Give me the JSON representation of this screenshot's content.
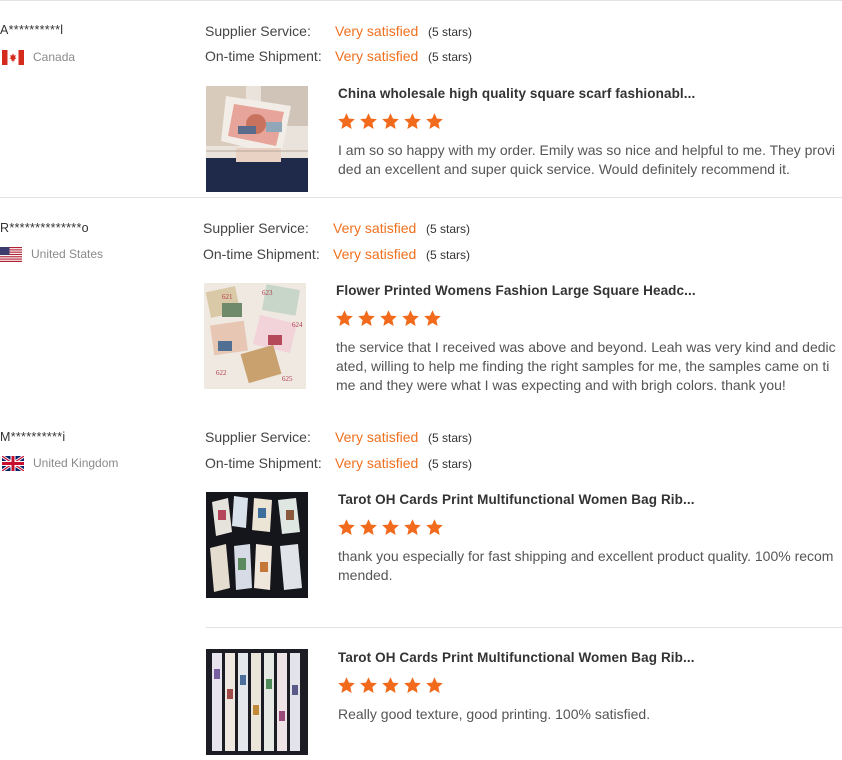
{
  "labels": {
    "supplier_service": "Supplier Service:",
    "ontime_shipment": "On-time Shipment:"
  },
  "reviews": [
    {
      "user": "A**********l",
      "country": "Canada",
      "supplier_value": "Very satisfied",
      "supplier_stars": "(5 stars)",
      "shipment_value": "Very satisfied",
      "shipment_stars": "(5 stars)",
      "products": [
        {
          "title": "China wholesale high quality square scarf fashionabl...",
          "rating": 5,
          "comment": "I am so so happy with my order. Emily was so nice and helpful to me. They provided an excellent and super quick service. Would definitely recommend it."
        }
      ]
    },
    {
      "user": "R**************o",
      "country": "United States",
      "supplier_value": "Very satisfied",
      "supplier_stars": "(5 stars)",
      "shipment_value": "Very satisfied",
      "shipment_stars": "(5 stars)",
      "products": [
        {
          "title": "Flower Printed Womens Fashion Large Square Headc...",
          "rating": 5,
          "comment": "the service that I received was above and beyond.  Leah was very kind and dedicated, willing to help me finding the right samples for me, the samples came on time and they were what I was expecting and with brigh colors. thank you!",
          "image_labels": [
            "621",
            "623",
            "624",
            "622",
            "625"
          ]
        }
      ]
    },
    {
      "user": "M**********i",
      "country": "United Kingdom",
      "supplier_value": "Very satisfied",
      "supplier_stars": "(5 stars)",
      "shipment_value": "Very satisfied",
      "shipment_stars": "(5 stars)",
      "products": [
        {
          "title": "Tarot OH Cards Print Multifunctional Women Bag Rib...",
          "rating": 5,
          "comment": "thank you especially for fast shipping and excellent product quality.  100% recommended."
        },
        {
          "title": "Tarot OH Cards Print Multifunctional Women Bag Rib...",
          "rating": 5,
          "comment": "Really good texture, good printing. 100% satisfied."
        }
      ]
    }
  ],
  "colors": {
    "accent": "#f0701e",
    "star": "#f26a1b",
    "divider": "#e3e3e3"
  },
  "icons": {
    "star": "star-icon",
    "flags": [
      "canada-flag-icon",
      "usa-flag-icon",
      "uk-flag-icon"
    ]
  }
}
